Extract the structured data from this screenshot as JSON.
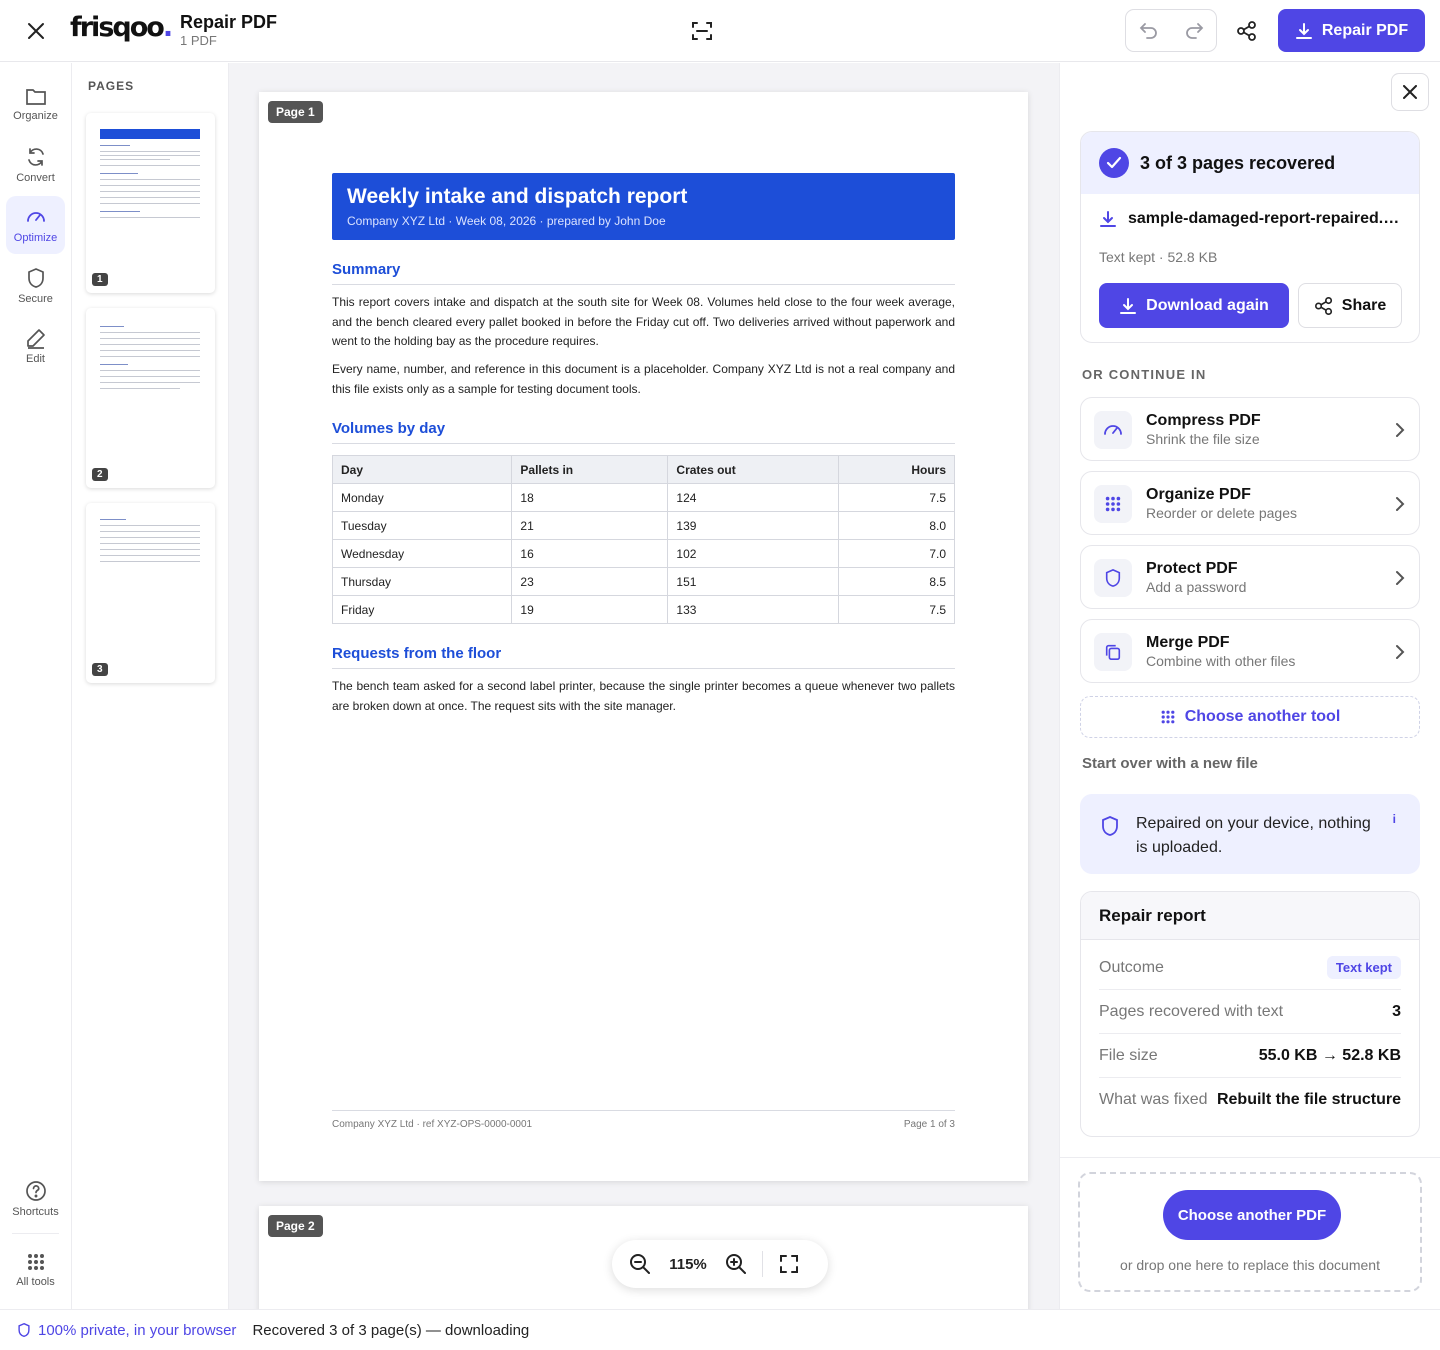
{
  "header": {
    "logo_text": "frisqoo",
    "logo_dot": ".",
    "title": "Repair PDF",
    "subtitle": "1 PDF",
    "primary_button": "Repair PDF"
  },
  "rail": {
    "items": [
      {
        "label": "Organize",
        "icon": "folder-icon"
      },
      {
        "label": "Convert",
        "icon": "refresh-icon"
      },
      {
        "label": "Optimize",
        "icon": "gauge-icon"
      },
      {
        "label": "Secure",
        "icon": "shield-icon"
      },
      {
        "label": "Edit",
        "icon": "pencil-icon"
      }
    ],
    "active": "Optimize",
    "bottom": [
      {
        "label": "Shortcuts",
        "icon": "help-icon"
      },
      {
        "label": "All tools",
        "icon": "grid-icon"
      }
    ]
  },
  "thumbnails": {
    "title": "PAGES",
    "pages": [
      "1",
      "2",
      "3"
    ]
  },
  "viewer": {
    "page1_tag": "Page 1",
    "page2_tag": "Page 2",
    "zoom": "115%"
  },
  "document": {
    "title": "Weekly intake and dispatch report",
    "subtitle": "Company XYZ Ltd · Week 08, 2026 · prepared by John Doe",
    "summary_heading": "Summary",
    "summary_p1": "This report covers intake and dispatch at the south site for Week 08. Volumes held close to the four week average, and the bench cleared every pallet booked in before the Friday cut off. Two deliveries arrived without paperwork and went to the holding bay as the procedure requires.",
    "summary_p2": "Every name, number, and reference in this document is a placeholder. Company XYZ Ltd is not a real company and this file exists only as a sample for testing document tools.",
    "volumes_heading": "Volumes by day",
    "table": {
      "headers": [
        "Day",
        "Pallets in",
        "Crates out",
        "Hours"
      ],
      "rows": [
        [
          "Monday",
          "18",
          "124",
          "7.5"
        ],
        [
          "Tuesday",
          "21",
          "139",
          "8.0"
        ],
        [
          "Wednesday",
          "16",
          "102",
          "7.0"
        ],
        [
          "Thursday",
          "23",
          "151",
          "8.5"
        ],
        [
          "Friday",
          "19",
          "133",
          "7.5"
        ]
      ]
    },
    "requests_heading": "Requests from the floor",
    "requests_p": "The bench team asked for a second label printer, because the single printer becomes a queue whenever two pallets are broken down at once. The request sits with the site manager.",
    "footer_left": "Company XYZ Ltd · ref XYZ-OPS-0000-0001",
    "footer_right": "Page 1 of 3"
  },
  "panel": {
    "recovered_title": "3 of 3 pages recovered",
    "file_name": "sample-damaged-report-repaired.pdf",
    "file_meta": "Text kept · 52.8 KB",
    "download_label": "Download again",
    "share_label": "Share",
    "continue_label": "OR CONTINUE IN",
    "tools": [
      {
        "title": "Compress PDF",
        "sub": "Shrink the file size",
        "icon": "gauge-icon"
      },
      {
        "title": "Organize PDF",
        "sub": "Reorder or delete pages",
        "icon": "grid-icon"
      },
      {
        "title": "Protect PDF",
        "sub": "Add a password",
        "icon": "shield-icon"
      },
      {
        "title": "Merge PDF",
        "sub": "Combine with other files",
        "icon": "copy-icon"
      }
    ],
    "another_tool": "Choose another tool",
    "start_over": "Start over with a new file",
    "privacy_text": "Repaired on your device, nothing is uploaded.",
    "privacy_info": "i",
    "report": {
      "title": "Repair report",
      "rows": [
        {
          "key": "Outcome",
          "value": "Text kept"
        },
        {
          "key": "Pages recovered with text",
          "value": "3"
        },
        {
          "key": "File size",
          "value": "55.0 KB → 52.8 KB"
        },
        {
          "key": "What was fixed",
          "value": "Rebuilt the file structure"
        }
      ]
    },
    "choose_pdf": "Choose another PDF",
    "drop_text": "or drop one here to replace this document"
  },
  "status": {
    "privacy": "100% private, in your browser",
    "message": "Recovered 3 of 3 page(s) — downloading"
  },
  "colors": {
    "accent": "#4f46e5",
    "doc_blue": "#1d4ed8"
  }
}
